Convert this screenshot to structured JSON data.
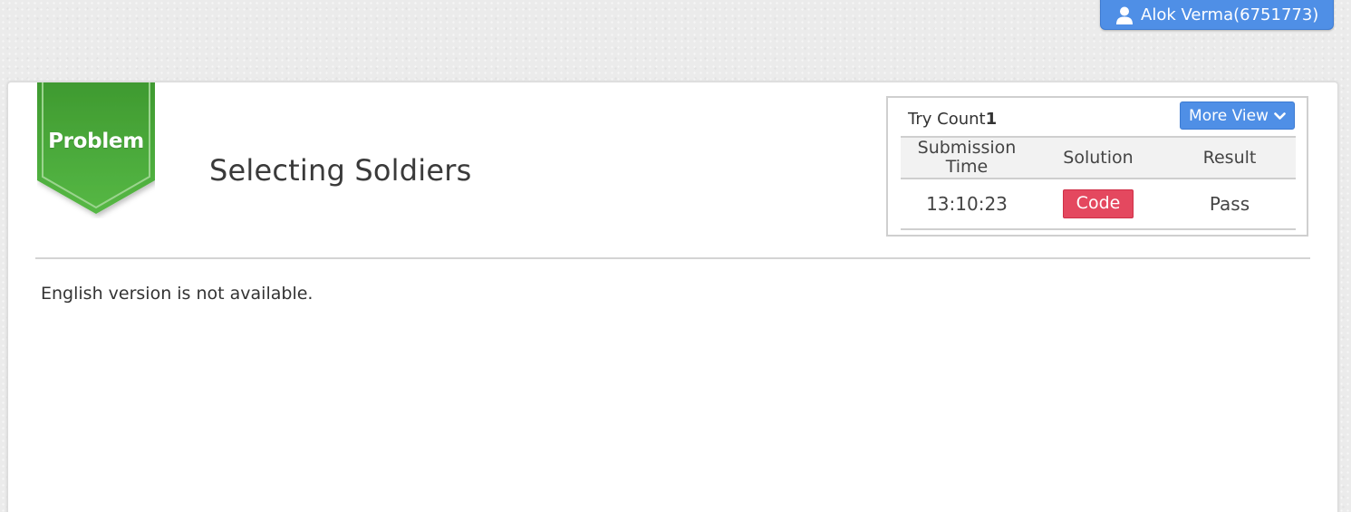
{
  "user": {
    "name": "Alok Verma(6751773)",
    "icon": "user-icon"
  },
  "ribbon": {
    "label": "Problem",
    "color": "#4aa83a"
  },
  "problem": {
    "title": "Selecting Soldiers",
    "notice": "English version is not available."
  },
  "submissions": {
    "try_count_label": "Try Count",
    "try_count_value": "1",
    "more_view_label": "More View",
    "more_view_icon": "chevron-down-icon",
    "columns": [
      "Submission Time",
      "Solution",
      "Result"
    ],
    "rows": [
      {
        "time": "13:10:23",
        "solution": "Code",
        "result": "Pass"
      }
    ]
  },
  "colors": {
    "accent": "#4f8fe6",
    "code_button": "#e4485f",
    "ribbon_green": "#4aa83a"
  }
}
